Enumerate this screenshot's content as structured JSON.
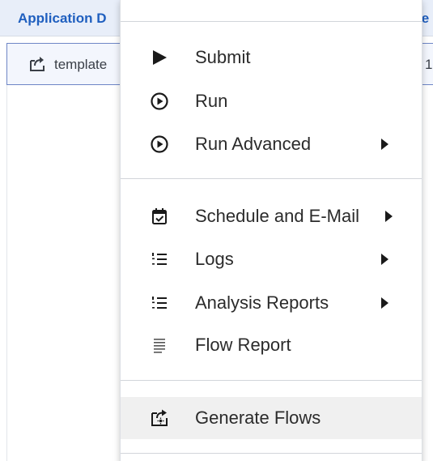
{
  "table": {
    "headers": {
      "application": "Application D",
      "right_partial": "ie"
    },
    "row": {
      "name": "template",
      "right_partial": "1"
    }
  },
  "menu": {
    "items": [
      {
        "label": "Submit",
        "icon": "play-solid-icon",
        "submenu": false
      },
      {
        "label": "Run",
        "icon": "play-circle-icon",
        "submenu": false
      },
      {
        "label": "Run Advanced",
        "icon": "play-circle-icon",
        "submenu": true
      },
      {
        "label": "Schedule and E-Mail",
        "icon": "calendar-check-icon",
        "submenu": true
      },
      {
        "label": "Logs",
        "icon": "list-numbered-icon",
        "submenu": true
      },
      {
        "label": "Analysis Reports",
        "icon": "list-numbered-icon",
        "submenu": true
      },
      {
        "label": "Flow Report",
        "icon": "lines-icon",
        "submenu": false
      },
      {
        "label": "Generate Flows",
        "icon": "generate-flows-icon",
        "submenu": false,
        "highlighted": true
      }
    ]
  },
  "colors": {
    "header_bg": "#e8eef9",
    "header_text": "#1f5fbf",
    "row_border": "#6e86c6",
    "menu_highlight": "#f0f0f0"
  }
}
